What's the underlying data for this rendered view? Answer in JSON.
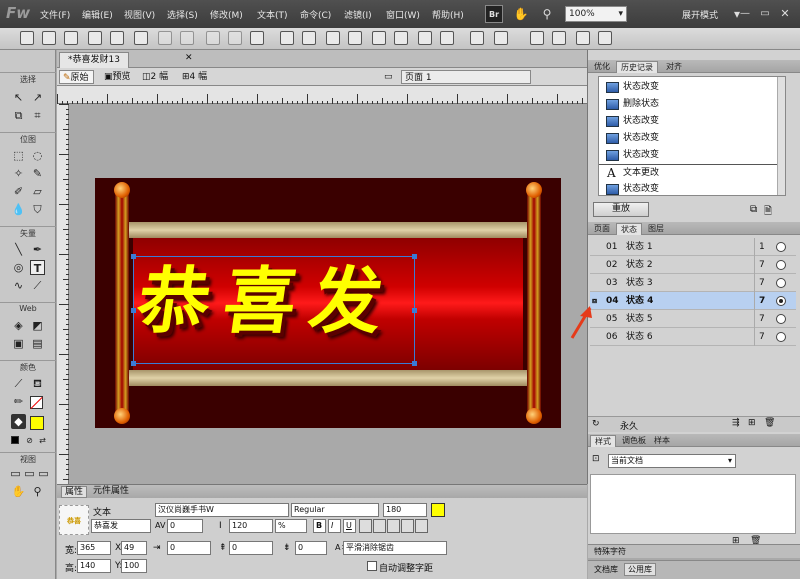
{
  "menu": {
    "logo": "Fw",
    "items": [
      "文件(F)",
      "编辑(E)",
      "视图(V)",
      "选择(S)",
      "修改(M)",
      "文本(T)",
      "命令(C)",
      "滤镜(I)",
      "窗口(W)",
      "帮助(H)"
    ],
    "br": "Br",
    "zoom": "100%",
    "expand_mode": "展开模式"
  },
  "tools": {
    "sections": [
      "选择",
      "位图",
      "矢量",
      "Web",
      "颜色",
      "视图"
    ]
  },
  "doc": {
    "tab": "*恭喜发财13",
    "views": [
      "原始",
      "预览",
      "2 幅",
      "4 幅"
    ],
    "page": "页面 1"
  },
  "artwork": {
    "text": "恭喜发"
  },
  "props": {
    "tabs": [
      "属性",
      "元件属性"
    ],
    "type_label": "文本",
    "object_name": "恭喜发",
    "font": "汉仪尚巍手书W",
    "style": "Regular",
    "size": "180",
    "kerning": "0",
    "leading": "120",
    "leading_unit": "%",
    "bold": "B",
    "italic": "I",
    "underline": "U",
    "w_label": "宽:",
    "w": "365",
    "x_label": "X:",
    "x": "49",
    "h_label": "高:",
    "h": "140",
    "y_label": "Y:",
    "y": "100",
    "indent": "0",
    "space_before": "0",
    "space_after": "0",
    "baseline": "0",
    "aa": "平滑消除锯齿",
    "auto_kern": "自动调整字距",
    "text_color": "#ffff00"
  },
  "history": {
    "tabs": [
      "优化",
      "历史记录",
      "对齐"
    ],
    "rows": [
      "状态改变",
      "删除状态",
      "状态改变",
      "状态改变",
      "状态改变",
      "文本更改",
      "状态改变"
    ],
    "replay": "重放"
  },
  "states": {
    "tabs": [
      "页面",
      "状态",
      "图层"
    ],
    "rows": [
      {
        "num": "01",
        "name": "状态 1",
        "delay": "1"
      },
      {
        "num": "02",
        "name": "状态 2",
        "delay": "7"
      },
      {
        "num": "03",
        "name": "状态 3",
        "delay": "7"
      },
      {
        "num": "04",
        "name": "状态 4",
        "delay": "7"
      },
      {
        "num": "05",
        "name": "状态 5",
        "delay": "7"
      },
      {
        "num": "06",
        "name": "状态 6",
        "delay": "7"
      }
    ],
    "loop": "永久"
  },
  "styles": {
    "tabs": [
      "样式",
      "调色板",
      "样本"
    ],
    "doc": "当前文档"
  },
  "bottom": {
    "special": "特殊字符",
    "tabs": [
      "文档库",
      "公用库"
    ]
  }
}
